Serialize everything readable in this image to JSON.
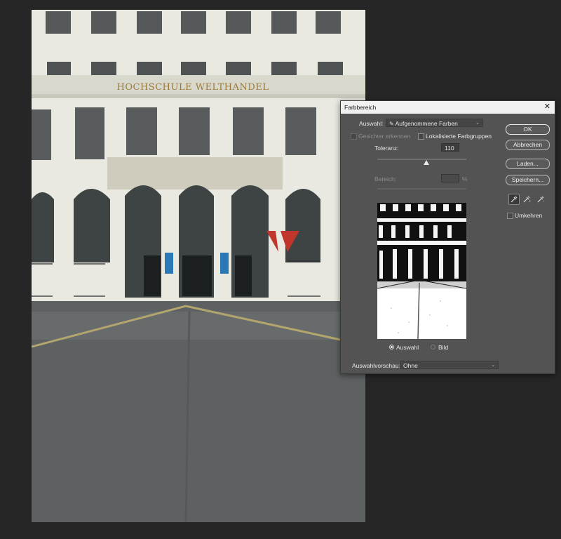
{
  "canvas": {
    "building_sign": "HOCHSCHULE WELTHANDEL"
  },
  "dialog": {
    "title": "Farbbereich",
    "close_icon": "close-icon",
    "select_label": "Auswahl:",
    "select_value": "Aufgenommene Farben",
    "detect_faces_label": "Gesichter erkennen",
    "localized_label": "Lokalisierte Farbgruppen",
    "tolerance_label": "Toleranz:",
    "tolerance_value": "110",
    "tolerance_fraction": 0.55,
    "range_label": "Bereich:",
    "range_unit": "%",
    "radio_selection": "Auswahl",
    "radio_image": "Bild",
    "preview_label": "Auswahlvorschau:",
    "preview_value": "Ohne",
    "buttons": {
      "ok": "OK",
      "cancel": "Abbrechen",
      "load": "Laden...",
      "save": "Speichern..."
    },
    "invert_label": "Umkehren",
    "eyedroppers": [
      "eyedropper-icon",
      "eyedropper-plus-icon",
      "eyedropper-minus-icon"
    ],
    "colors": {
      "panel": "#535353",
      "titlebar": "#f0f0f0"
    }
  }
}
